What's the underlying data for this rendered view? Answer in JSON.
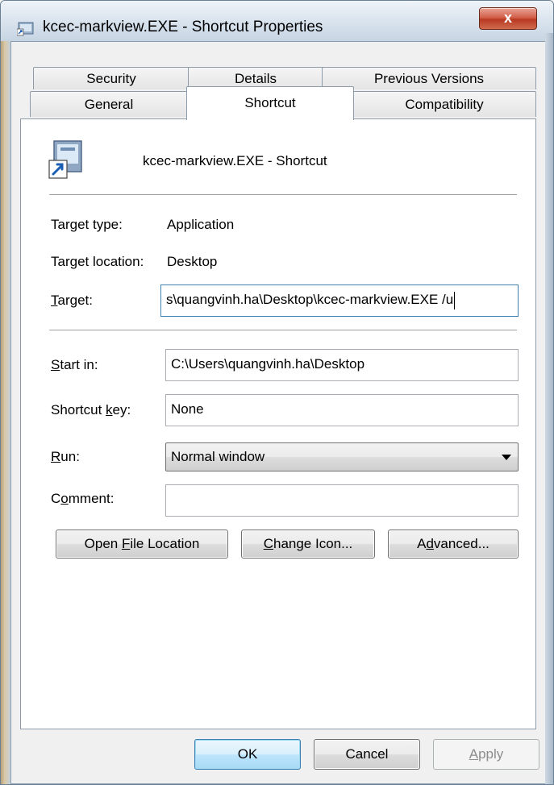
{
  "window": {
    "title": "kcec-markview.EXE - Shortcut Properties",
    "close_label": "x"
  },
  "tabs": {
    "security": "Security",
    "details": "Details",
    "previous_versions": "Previous Versions",
    "general": "General",
    "shortcut": "Shortcut",
    "compatibility": "Compatibility"
  },
  "shortcut": {
    "name": "kcec-markview.EXE - Shortcut",
    "target_type_label": "Target type:",
    "target_type_value": "Application",
    "target_location_label": "Target location:",
    "target_location_value": "Desktop",
    "target_label_prefix": "",
    "target_label_key": "T",
    "target_label_rest": "arget:",
    "target_value": "s\\quangvinh.ha\\Desktop\\kcec-markview.EXE /u",
    "start_in_key": "S",
    "start_in_rest": "tart in:",
    "start_in_value": "C:\\Users\\quangvinh.ha\\Desktop",
    "shortcut_key_prefix": "Shortcut ",
    "shortcut_key_key": "k",
    "shortcut_key_rest": "ey:",
    "shortcut_key_value": "None",
    "run_key": "R",
    "run_rest": "un:",
    "run_value": "Normal window",
    "comment_prefix": "C",
    "comment_key": "o",
    "comment_rest": "mment:",
    "comment_value": ""
  },
  "buttons": {
    "open_file_prefix": "Open ",
    "open_file_key": "F",
    "open_file_rest": "ile Location",
    "change_icon_key": "C",
    "change_icon_rest": "hange Icon...",
    "advanced_prefix": "A",
    "advanced_key": "d",
    "advanced_rest": "vanced...",
    "ok": "OK",
    "cancel": "Cancel",
    "apply_key": "A",
    "apply_rest": "pply"
  },
  "colors": {
    "focus_border": "#3c7fb1",
    "close_button": "#c4452c"
  }
}
